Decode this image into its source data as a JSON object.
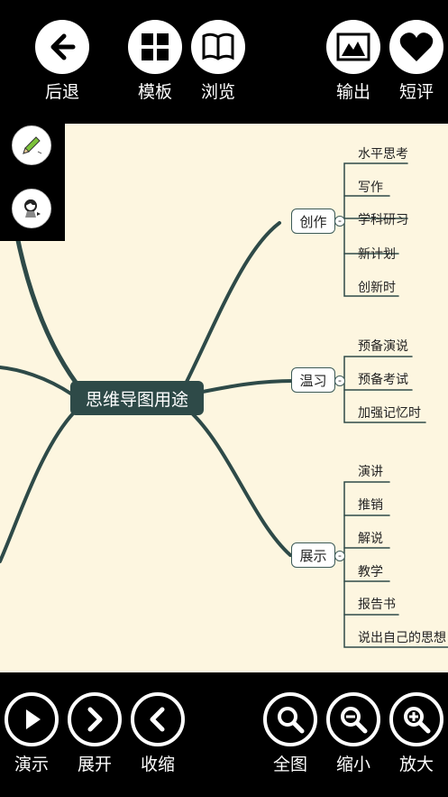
{
  "toolbar": {
    "back": "后退",
    "template": "模板",
    "browse": "浏览",
    "export": "输出",
    "comment": "短评"
  },
  "mindmap": {
    "root": "思维导图用途",
    "branches": [
      {
        "label": "创作",
        "children": [
          "水平思考",
          "写作",
          "学科研习",
          "新计划",
          "创新时"
        ]
      },
      {
        "label": "温习",
        "children": [
          "预备演说",
          "预备考试",
          "加强记忆时"
        ]
      },
      {
        "label": "展示",
        "children": [
          "演讲",
          "推销",
          "解说",
          "教学",
          "报告书",
          "说出自己的思想"
        ]
      }
    ]
  },
  "bottom_bar": {
    "present": "演示",
    "expand": "展开",
    "collapse": "收缩",
    "fit": "全图",
    "zoom_out": "缩小",
    "zoom_in": "放大"
  },
  "colors": {
    "canvas_bg": "#fdf6e0",
    "root_bg": "#2e4a48",
    "branch_line": "#2e4a48",
    "toolbar_bg": "#000000"
  }
}
